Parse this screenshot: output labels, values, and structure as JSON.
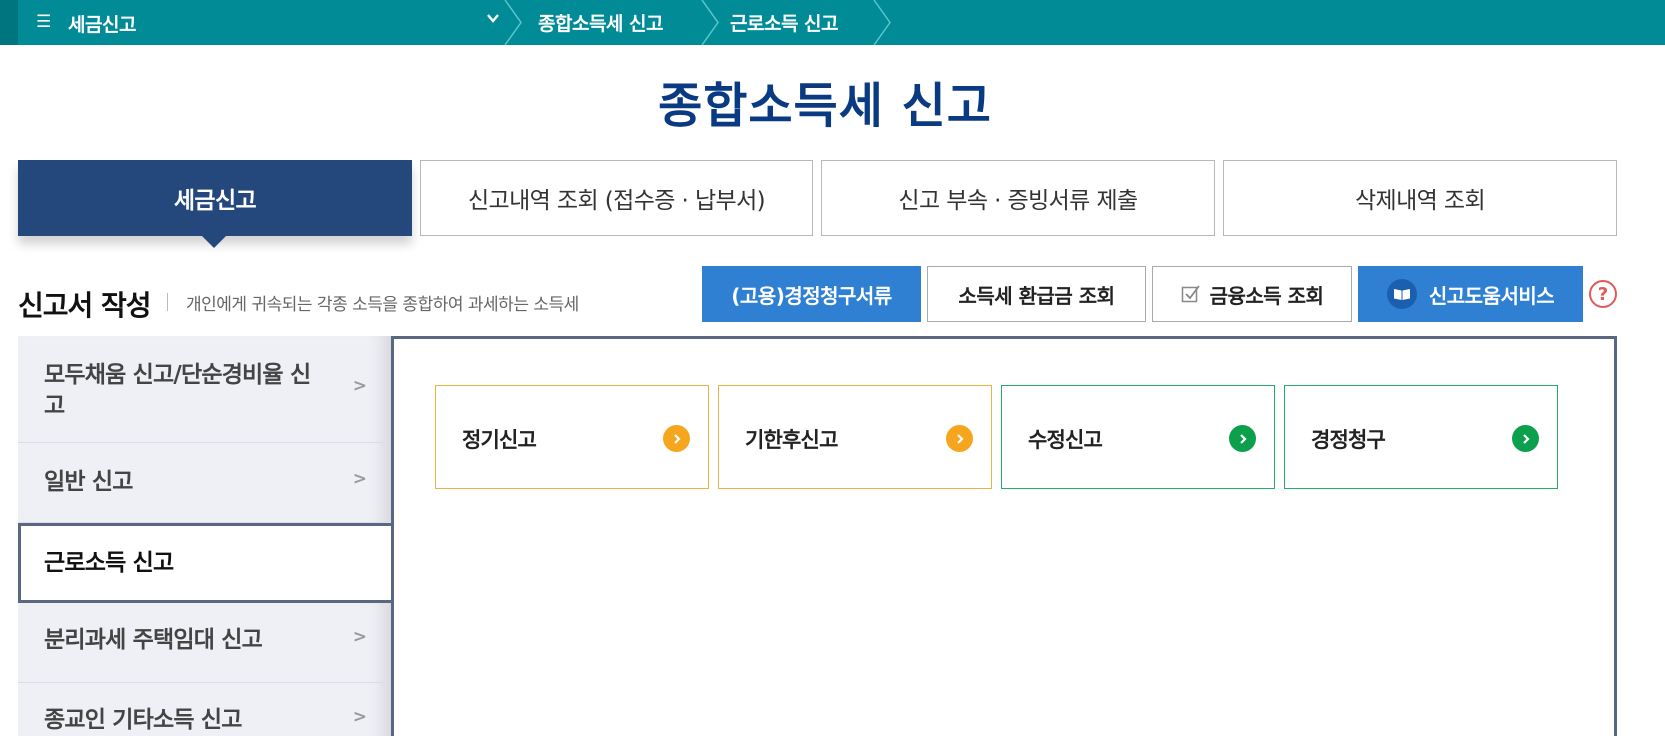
{
  "breadcrumb": {
    "menu_label": "세금신고",
    "items": [
      "종합소득세 신고",
      "근로소득 신고"
    ]
  },
  "page_title": "종합소득세 신고",
  "tabs": [
    {
      "label": "세금신고",
      "active": true
    },
    {
      "label": "신고내역 조회 (접수증 · 납부서)",
      "active": false
    },
    {
      "label": "신고 부속 · 증빙서류 제출",
      "active": false
    },
    {
      "label": "삭제내역 조회",
      "active": false
    }
  ],
  "section": {
    "title": "신고서 작성",
    "description": "개인에게 귀속되는 각종 소득을 종합하여 과세하는 소득세"
  },
  "action_buttons": {
    "correction_docs": "(고용)경정청구서류",
    "refund_lookup": "소득세 환급금 조회",
    "financial_income": "금융소득 조회",
    "filing_help": "신고도움서비스",
    "help": "?"
  },
  "sidebar": {
    "items": [
      {
        "label": "모두채움 신고/단순경비율 신고",
        "active": false
      },
      {
        "label": "일반 신고",
        "active": false
      },
      {
        "label": "근로소득 신고",
        "active": true
      },
      {
        "label": "분리과세 주택임대 신고",
        "active": false
      },
      {
        "label": "종교인 기타소득 신고",
        "active": false
      }
    ]
  },
  "cards": [
    {
      "label": "정기신고",
      "color": "#f6a51f"
    },
    {
      "label": "기한후신고",
      "color": "#f6a51f"
    },
    {
      "label": "수정신고",
      "color": "#0c9f4c"
    },
    {
      "label": "경정청구",
      "color": "#0c9f4c"
    }
  ],
  "colors": {
    "topbar": "#008b96",
    "title": "#0a3a82",
    "active_tab": "#24487c",
    "primary_button": "#2f7fd3"
  }
}
